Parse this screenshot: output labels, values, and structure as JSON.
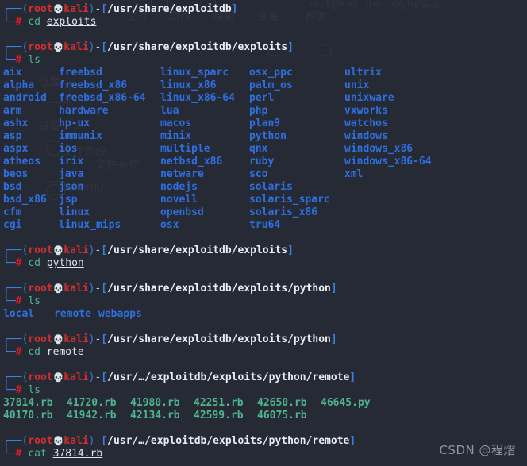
{
  "terminal": {
    "background": "#262a35",
    "prompt": {
      "top_corner": "┌──",
      "bottom_corner": "└─",
      "open_paren": "(",
      "user": "root",
      "skull": "💀",
      "host": "kali",
      "close_paren": ")",
      "dash": "-",
      "open_bracket": "[",
      "close_bracket": "]",
      "hash": "#"
    },
    "colors": {
      "directory": "#2f6fe0",
      "file": "#4fb58f",
      "user": "#d32f2f",
      "bracket": "#3b7fe0",
      "command": "#4fb58f",
      "path": "#e8edf5"
    }
  },
  "blocks": [
    {
      "path": "/usr/share/exploitdb",
      "command": "cd",
      "argument": "exploits"
    },
    {
      "path": "/usr/share/exploitdb/exploits",
      "command": "ls",
      "argument": ""
    },
    {
      "path": "/usr/share/exploitdb/exploits",
      "command": "cd",
      "argument": "python"
    },
    {
      "path": "/usr/share/exploitdb/exploits/python",
      "command": "ls",
      "argument": ""
    },
    {
      "path": "/usr/share/exploitdb/exploits/python",
      "command": "cd",
      "argument": "remote"
    },
    {
      "path": "/usr/…/exploitdb/exploits/python/remote",
      "command": "ls",
      "argument": ""
    },
    {
      "path": "/usr/…/exploitdb/exploits/python/remote",
      "command": "cat",
      "argument": "37814.rb"
    }
  ],
  "exploits_listing": {
    "rows": [
      [
        "aix",
        "freebsd",
        "linux_sparc",
        "osx_ppc",
        "ultrix"
      ],
      [
        "alpha",
        "freebsd_x86",
        "linux_x86",
        "palm_os",
        "unix"
      ],
      [
        "android",
        "freebsd_x86-64",
        "linux_x86-64",
        "perl",
        "unixware"
      ],
      [
        "arm",
        "hardware",
        "lua",
        "php",
        "vxworks"
      ],
      [
        "ashx",
        "hp-ux",
        "macos",
        "plan9",
        "watchos"
      ],
      [
        "asp",
        "immunix",
        "minix",
        "python",
        "windows"
      ],
      [
        "aspx",
        "ios",
        "multiple",
        "qnx",
        "windows_x86"
      ],
      [
        "atheos",
        "irix",
        "netbsd_x86",
        "ruby",
        "windows_x86-64"
      ],
      [
        "beos",
        "java",
        "netware",
        "sco",
        "xml"
      ],
      [
        "bsd",
        "json",
        "nodejs",
        "solaris",
        ""
      ],
      [
        "bsd_x86",
        "jsp",
        "novell",
        "solaris_sparc",
        ""
      ],
      [
        "cfm",
        "linux",
        "openbsd",
        "solaris_x86",
        ""
      ],
      [
        "cgi",
        "linux_mips",
        "osx",
        "tru64",
        ""
      ]
    ]
  },
  "python_listing": {
    "items": [
      "local",
      "remote",
      "webapps"
    ]
  },
  "remote_listing": {
    "rows": [
      [
        "37814.rb",
        "41720.rb",
        "41980.rb",
        "42251.rb",
        "42650.rb",
        "46645.py"
      ],
      [
        "40170.rb",
        "41942.rb",
        "42134.rb",
        "42599.rb",
        "46075.rb",
        ""
      ]
    ]
  },
  "ghost_menu": {
    "items": [
      "文件",
      "动作",
      "编辑",
      "查看",
      "帮助"
    ],
    "title": "root@kali: /home/jjfq/桌面",
    "sidebar": [
      "位置",
      "设备",
      "文件系统",
      "cdrom0"
    ]
  },
  "watermark": {
    "text": "CSDN @程熠"
  }
}
